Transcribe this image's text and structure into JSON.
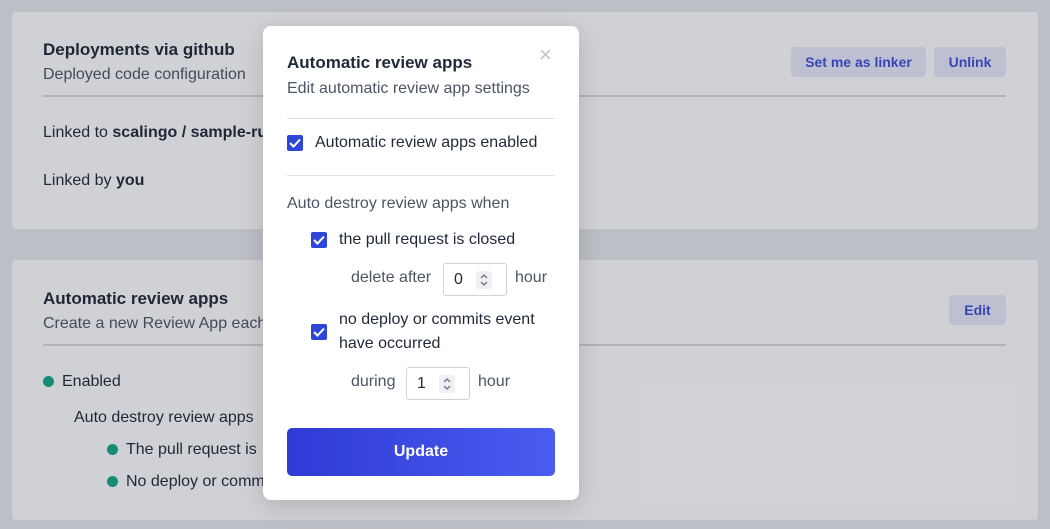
{
  "deploy_card": {
    "title": "Deployments via github",
    "subtitle": "Deployed code configuration",
    "set_linker_label": "Set me as linker",
    "unlink_label": "Unlink",
    "linked_to_prefix": "Linked to ",
    "linked_to_repo": "scalingo / sample-ru",
    "linked_by_prefix": "Linked by ",
    "linked_by_user": "you"
  },
  "review_card": {
    "title": "Automatic review apps",
    "subtitle": "Create a new Review App each",
    "edit_label": "Edit",
    "status": "Enabled",
    "auto_destroy_label": "Auto destroy review apps",
    "condition_1": "The pull request is",
    "condition_2": "No deploy or comm"
  },
  "modal": {
    "title": "Automatic review apps",
    "subtitle": "Edit automatic review app settings",
    "close_glyph": "×",
    "enabled_label": "Automatic review apps enabled",
    "enabled_checked": true,
    "auto_destroy_heading": "Auto destroy review apps when",
    "pr_closed_label": "the pull request is closed",
    "pr_closed_checked": true,
    "delete_after_label": "delete after",
    "delete_after_value": "0",
    "delete_after_unit": "hour",
    "no_deploy_label_line1": "no deploy or commits event",
    "no_deploy_label_line2": "have occurred",
    "no_deploy_checked": true,
    "during_label": "during",
    "during_value": "1",
    "during_unit": "hour",
    "update_label": "Update"
  },
  "colors": {
    "accent": "#2f47d6",
    "soft_button_bg": "#e6e8fb",
    "soft_button_text": "#3d4fd8",
    "status_dot": "#13a58a"
  }
}
